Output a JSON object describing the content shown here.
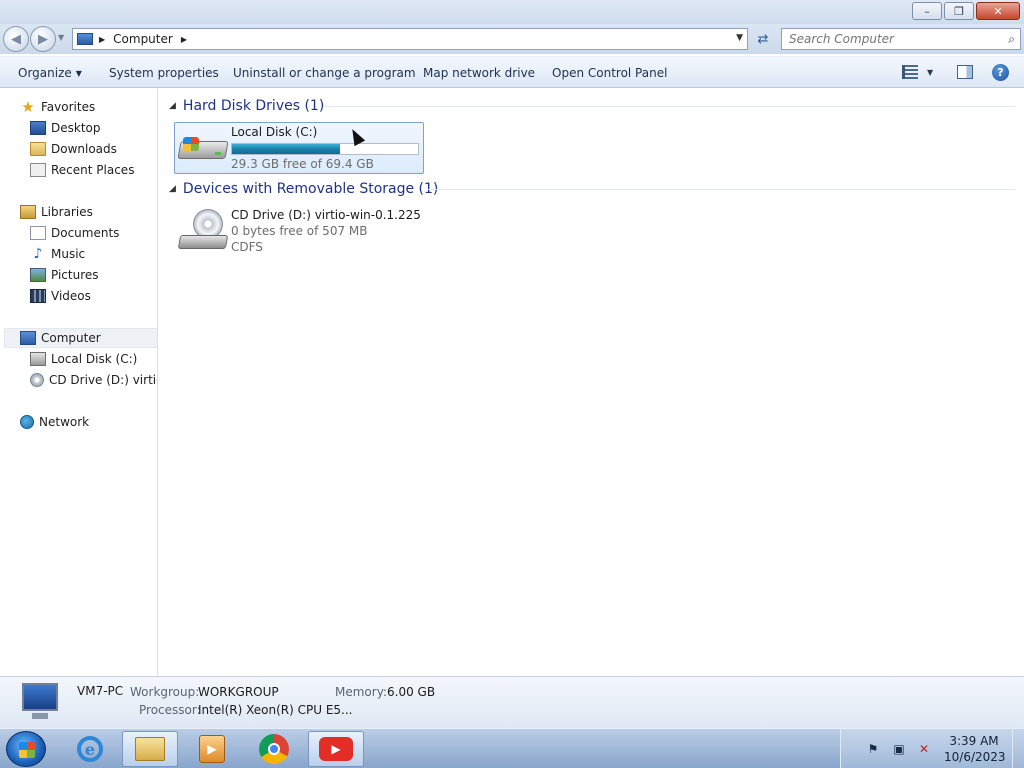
{
  "window": {
    "controls": {
      "minimize": "–",
      "restore": "❐",
      "close": "✕"
    }
  },
  "address": {
    "path": [
      "Computer"
    ],
    "search_placeholder": "Search Computer"
  },
  "toolbar": {
    "organize": "Organize",
    "system_properties": "System properties",
    "uninstall": "Uninstall or change a program",
    "map_drive": "Map network drive",
    "control_panel": "Open Control Panel"
  },
  "nav": {
    "favorites": {
      "label": "Favorites",
      "items": [
        "Desktop",
        "Downloads",
        "Recent Places"
      ]
    },
    "libraries": {
      "label": "Libraries",
      "items": [
        "Documents",
        "Music",
        "Pictures",
        "Videos"
      ]
    },
    "computer": {
      "label": "Computer",
      "items": [
        "Local Disk (C:)",
        "CD Drive (D:) virtio-win-0.1.225"
      ]
    },
    "network": {
      "label": "Network"
    }
  },
  "content": {
    "groups": [
      {
        "header": "Hard Disk Drives (1)",
        "drives": [
          {
            "name": "Local Disk (C:)",
            "free_text": "29.3 GB free of 69.4 GB",
            "used_fraction": 0.58
          }
        ]
      },
      {
        "header": "Devices with Removable Storage (1)",
        "drives": [
          {
            "name": "CD Drive (D:) virtio-win-0.1.225",
            "free_text": "0 bytes free of 507 MB",
            "fs": "CDFS"
          }
        ]
      }
    ]
  },
  "details": {
    "name": "VM7-PC",
    "workgroup_label": "Workgroup:",
    "workgroup": "WORKGROUP",
    "memory_label": "Memory:",
    "memory": "6.00 GB",
    "processor_label": "Processor:",
    "processor": "Intel(R) Xeon(R) CPU E5..."
  },
  "taskbar": {
    "apps": [
      "Internet Explorer",
      "Windows Explorer",
      "Windows Media Player",
      "Google Chrome",
      "YouTube"
    ],
    "ie_glyph": "e",
    "media_glyph": "▶",
    "yt_glyph": "▶",
    "time": "3:39 AM",
    "date": "10/6/2023"
  }
}
